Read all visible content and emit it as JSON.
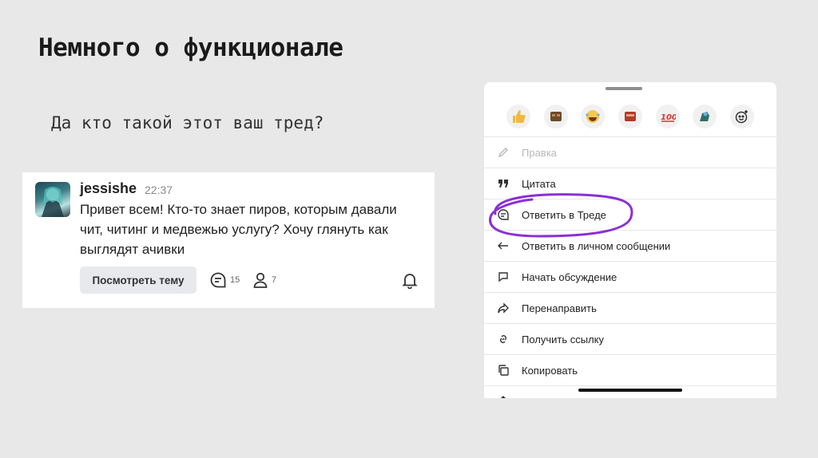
{
  "slide": {
    "title": "Немного о функционале",
    "subtitle": "Да кто такой этот ваш тред?"
  },
  "message": {
    "author": "jessishe",
    "time": "22:37",
    "text": "Привет всем! Кто-то знает пиров, которым давали чит, читинг и медвежью услугу? Хочу глянуть как выглядят ачивки",
    "view_thread_label": "Посмотреть тему",
    "replies_count": "15",
    "members_count": "7",
    "icons": {
      "avatar": "avatar-image",
      "replies": "thread-replies-icon",
      "members": "person-icon",
      "notify": "bell-icon"
    }
  },
  "context_menu": {
    "reactions": [
      {
        "name": "thumbs-up"
      },
      {
        "name": "brown-emoji"
      },
      {
        "name": "laughing-tears"
      },
      {
        "name": "red-emoji"
      },
      {
        "name": "hundred-points"
      },
      {
        "name": "blue-green-emoji"
      },
      {
        "name": "add-reaction"
      }
    ],
    "items": [
      {
        "label": "Правка",
        "icon": "pencil-icon",
        "disabled": true
      },
      {
        "label": "Цитата",
        "icon": "quote-icon"
      },
      {
        "label": "Ответить в Треде",
        "icon": "thread-icon"
      },
      {
        "label": "Ответить в личном сообщении",
        "icon": "reply-arrow-icon"
      },
      {
        "label": "Начать обсуждение",
        "icon": "discussion-icon"
      },
      {
        "label": "Перенаправить",
        "icon": "forward-icon"
      },
      {
        "label": "Получить ссылку",
        "icon": "link-icon"
      },
      {
        "label": "Копировать",
        "icon": "copy-icon"
      }
    ]
  },
  "colors": {
    "slide_background": "#e8e8e8",
    "highlight": "#8b2fd6"
  }
}
